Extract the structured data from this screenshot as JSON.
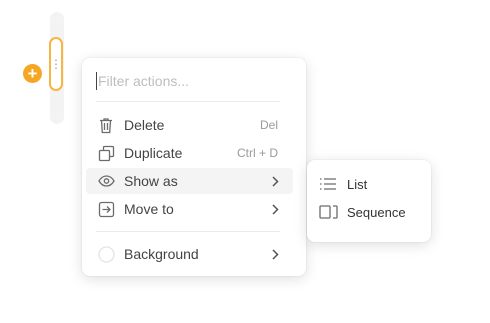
{
  "editor": {
    "add_icon": "plus-icon",
    "drag_icon": "vertical-dots-icon",
    "drag_glyph": "⋮",
    "add_glyph": "+",
    "accent_color": "#f5a623"
  },
  "menu": {
    "filter": {
      "placeholder": "Filter actions...",
      "value": ""
    },
    "items": [
      {
        "label": "Delete",
        "shortcut": "Del",
        "icon": "trash-icon"
      },
      {
        "label": "Duplicate",
        "shortcut": "Ctrl + D",
        "icon": "duplicate-icon"
      },
      {
        "label": "Show as",
        "icon": "eye-icon",
        "submenu": true,
        "active": true
      },
      {
        "label": "Move to",
        "icon": "move-to-icon",
        "submenu": true
      },
      {
        "label": "Background",
        "icon": "circle-icon",
        "submenu": true
      }
    ]
  },
  "submenu": {
    "items": [
      {
        "label": "List",
        "icon": "list-icon"
      },
      {
        "label": "Sequence",
        "icon": "sequence-icon"
      }
    ]
  }
}
